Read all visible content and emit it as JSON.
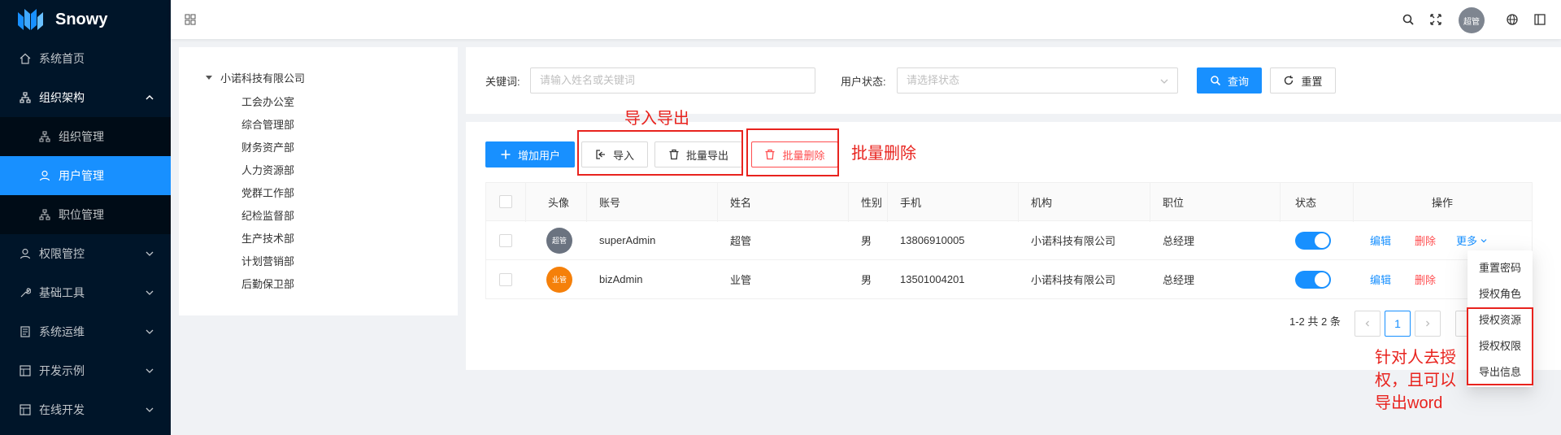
{
  "app": {
    "name": "Snowy"
  },
  "sidebar": {
    "items": [
      {
        "label": "系统首页",
        "icon": "home-icon"
      },
      {
        "label": "组织架构",
        "icon": "org-icon",
        "open": true
      },
      {
        "label": "组织管理",
        "icon": "org-icon"
      },
      {
        "label": "用户管理",
        "icon": "user-icon",
        "active": true
      },
      {
        "label": "职位管理",
        "icon": "org-icon"
      },
      {
        "label": "权限管控",
        "icon": "user-icon"
      },
      {
        "label": "基础工具",
        "icon": "tool-icon"
      },
      {
        "label": "系统运维",
        "icon": "file-icon"
      },
      {
        "label": "开发示例",
        "icon": "layout-icon"
      },
      {
        "label": "在线开发",
        "icon": "layout-icon"
      }
    ]
  },
  "header": {
    "avatar_text": "超管"
  },
  "tree": {
    "root": "小诺科技有限公司",
    "children": [
      "工会办公室",
      "综合管理部",
      "财务资产部",
      "人力资源部",
      "党群工作部",
      "纪检监督部",
      "生产技术部",
      "计划营销部",
      "后勤保卫部"
    ]
  },
  "search": {
    "keyword_label": "关键词:",
    "keyword_placeholder": "请输入姓名或关键词",
    "status_label": "用户状态:",
    "status_placeholder": "请选择状态",
    "query_label": "查询",
    "reset_label": "重置"
  },
  "toolbar": {
    "add_label": "增加用户",
    "import_label": "导入",
    "export_label": "批量导出",
    "delete_label": "批量删除"
  },
  "table": {
    "headers": [
      "头像",
      "账号",
      "姓名",
      "性别",
      "手机",
      "机构",
      "职位",
      "状态",
      "操作"
    ],
    "rows": [
      {
        "avatar": "超管",
        "avatar_color": "#6b7380",
        "account": "superAdmin",
        "name": "超管",
        "gender": "男",
        "phone": "13806910005",
        "org": "小诺科技有限公司",
        "position": "总经理",
        "enabled": true
      },
      {
        "avatar": "业管",
        "avatar_color": "#f5800a",
        "account": "bizAdmin",
        "name": "业管",
        "gender": "男",
        "phone": "13501004201",
        "org": "小诺科技有限公司",
        "position": "总经理",
        "enabled": true
      }
    ],
    "actions": {
      "edit": "编辑",
      "delete": "删除",
      "more": "更多"
    }
  },
  "pagination": {
    "summary": "1-2 共 2 条",
    "current": "1"
  },
  "more_menu": [
    "重置密码",
    "授权角色",
    "授权资源",
    "授权权限",
    "导出信息"
  ],
  "annotations": {
    "import_export": "导入导出",
    "batch_delete": "批量删除",
    "auth_note_1": "针对人去授",
    "auth_note_2": "权，且可以",
    "auth_note_3": "导出word"
  },
  "colors": {
    "primary": "#1890ff",
    "sidebar": "#001529",
    "danger": "#ff4d4f",
    "annotation": "#e8231e"
  }
}
